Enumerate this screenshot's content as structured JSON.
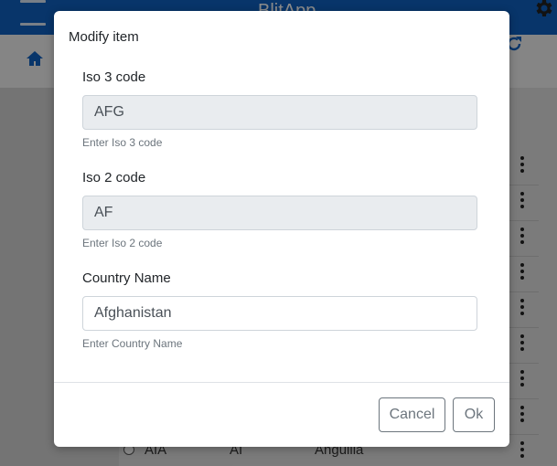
{
  "app": {
    "title": "BlitApp"
  },
  "background_table": {
    "visible_row": {
      "iso3": "AIA",
      "iso2": "AI",
      "country_name": "Anguilla"
    }
  },
  "modal": {
    "title": "Modify item",
    "fields": [
      {
        "label": "Iso 3 code",
        "value": "AFG",
        "help": "Enter Iso 3 code",
        "readonly": true
      },
      {
        "label": "Iso 2 code",
        "value": "AF",
        "help": "Enter Iso 2 code",
        "readonly": true
      },
      {
        "label": "Country Name",
        "value": "Afghanistan",
        "help": "Enter Country Name",
        "readonly": false
      }
    ],
    "buttons": {
      "cancel": "Cancel",
      "ok": "Ok"
    }
  },
  "colors": {
    "topbar": "#1062c2",
    "overlay": "rgba(0,0,0,0.45)"
  },
  "icons": [
    "hamburger-icon",
    "gear-icon",
    "home-icon",
    "refresh-icon",
    "kebab-menu-icon"
  ]
}
